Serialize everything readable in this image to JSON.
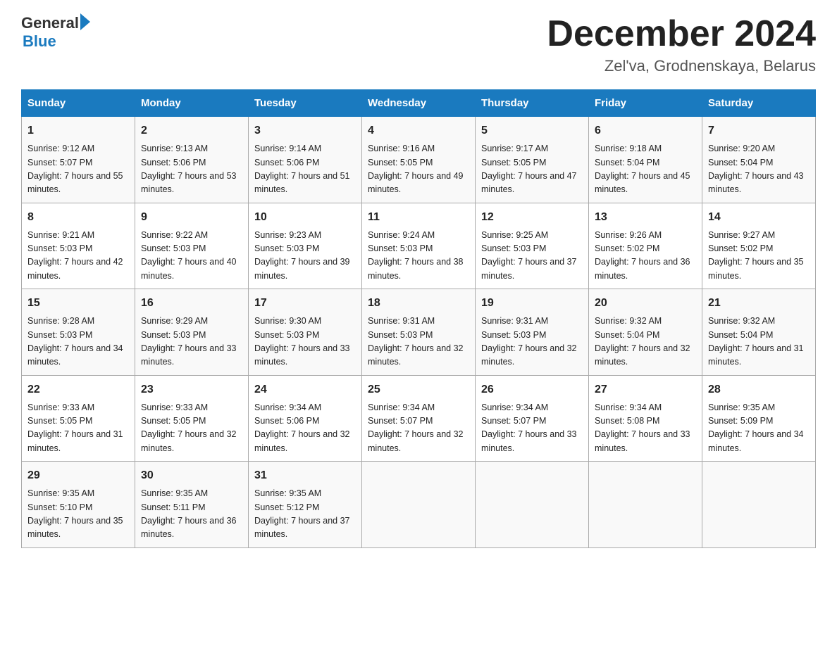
{
  "logo": {
    "text_general": "General",
    "text_blue": "Blue",
    "arrow": "▶"
  },
  "title": "December 2024",
  "subtitle": "Zel'va, Grodnenskaya, Belarus",
  "headers": [
    "Sunday",
    "Monday",
    "Tuesday",
    "Wednesday",
    "Thursday",
    "Friday",
    "Saturday"
  ],
  "weeks": [
    [
      {
        "day": "1",
        "sunrise": "9:12 AM",
        "sunset": "5:07 PM",
        "daylight": "7 hours and 55 minutes."
      },
      {
        "day": "2",
        "sunrise": "9:13 AM",
        "sunset": "5:06 PM",
        "daylight": "7 hours and 53 minutes."
      },
      {
        "day": "3",
        "sunrise": "9:14 AM",
        "sunset": "5:06 PM",
        "daylight": "7 hours and 51 minutes."
      },
      {
        "day": "4",
        "sunrise": "9:16 AM",
        "sunset": "5:05 PM",
        "daylight": "7 hours and 49 minutes."
      },
      {
        "day": "5",
        "sunrise": "9:17 AM",
        "sunset": "5:05 PM",
        "daylight": "7 hours and 47 minutes."
      },
      {
        "day": "6",
        "sunrise": "9:18 AM",
        "sunset": "5:04 PM",
        "daylight": "7 hours and 45 minutes."
      },
      {
        "day": "7",
        "sunrise": "9:20 AM",
        "sunset": "5:04 PM",
        "daylight": "7 hours and 43 minutes."
      }
    ],
    [
      {
        "day": "8",
        "sunrise": "9:21 AM",
        "sunset": "5:03 PM",
        "daylight": "7 hours and 42 minutes."
      },
      {
        "day": "9",
        "sunrise": "9:22 AM",
        "sunset": "5:03 PM",
        "daylight": "7 hours and 40 minutes."
      },
      {
        "day": "10",
        "sunrise": "9:23 AM",
        "sunset": "5:03 PM",
        "daylight": "7 hours and 39 minutes."
      },
      {
        "day": "11",
        "sunrise": "9:24 AM",
        "sunset": "5:03 PM",
        "daylight": "7 hours and 38 minutes."
      },
      {
        "day": "12",
        "sunrise": "9:25 AM",
        "sunset": "5:03 PM",
        "daylight": "7 hours and 37 minutes."
      },
      {
        "day": "13",
        "sunrise": "9:26 AM",
        "sunset": "5:02 PM",
        "daylight": "7 hours and 36 minutes."
      },
      {
        "day": "14",
        "sunrise": "9:27 AM",
        "sunset": "5:02 PM",
        "daylight": "7 hours and 35 minutes."
      }
    ],
    [
      {
        "day": "15",
        "sunrise": "9:28 AM",
        "sunset": "5:03 PM",
        "daylight": "7 hours and 34 minutes."
      },
      {
        "day": "16",
        "sunrise": "9:29 AM",
        "sunset": "5:03 PM",
        "daylight": "7 hours and 33 minutes."
      },
      {
        "day": "17",
        "sunrise": "9:30 AM",
        "sunset": "5:03 PM",
        "daylight": "7 hours and 33 minutes."
      },
      {
        "day": "18",
        "sunrise": "9:31 AM",
        "sunset": "5:03 PM",
        "daylight": "7 hours and 32 minutes."
      },
      {
        "day": "19",
        "sunrise": "9:31 AM",
        "sunset": "5:03 PM",
        "daylight": "7 hours and 32 minutes."
      },
      {
        "day": "20",
        "sunrise": "9:32 AM",
        "sunset": "5:04 PM",
        "daylight": "7 hours and 32 minutes."
      },
      {
        "day": "21",
        "sunrise": "9:32 AM",
        "sunset": "5:04 PM",
        "daylight": "7 hours and 31 minutes."
      }
    ],
    [
      {
        "day": "22",
        "sunrise": "9:33 AM",
        "sunset": "5:05 PM",
        "daylight": "7 hours and 31 minutes."
      },
      {
        "day": "23",
        "sunrise": "9:33 AM",
        "sunset": "5:05 PM",
        "daylight": "7 hours and 32 minutes."
      },
      {
        "day": "24",
        "sunrise": "9:34 AM",
        "sunset": "5:06 PM",
        "daylight": "7 hours and 32 minutes."
      },
      {
        "day": "25",
        "sunrise": "9:34 AM",
        "sunset": "5:07 PM",
        "daylight": "7 hours and 32 minutes."
      },
      {
        "day": "26",
        "sunrise": "9:34 AM",
        "sunset": "5:07 PM",
        "daylight": "7 hours and 33 minutes."
      },
      {
        "day": "27",
        "sunrise": "9:34 AM",
        "sunset": "5:08 PM",
        "daylight": "7 hours and 33 minutes."
      },
      {
        "day": "28",
        "sunrise": "9:35 AM",
        "sunset": "5:09 PM",
        "daylight": "7 hours and 34 minutes."
      }
    ],
    [
      {
        "day": "29",
        "sunrise": "9:35 AM",
        "sunset": "5:10 PM",
        "daylight": "7 hours and 35 minutes."
      },
      {
        "day": "30",
        "sunrise": "9:35 AM",
        "sunset": "5:11 PM",
        "daylight": "7 hours and 36 minutes."
      },
      {
        "day": "31",
        "sunrise": "9:35 AM",
        "sunset": "5:12 PM",
        "daylight": "7 hours and 37 minutes."
      },
      null,
      null,
      null,
      null
    ]
  ]
}
